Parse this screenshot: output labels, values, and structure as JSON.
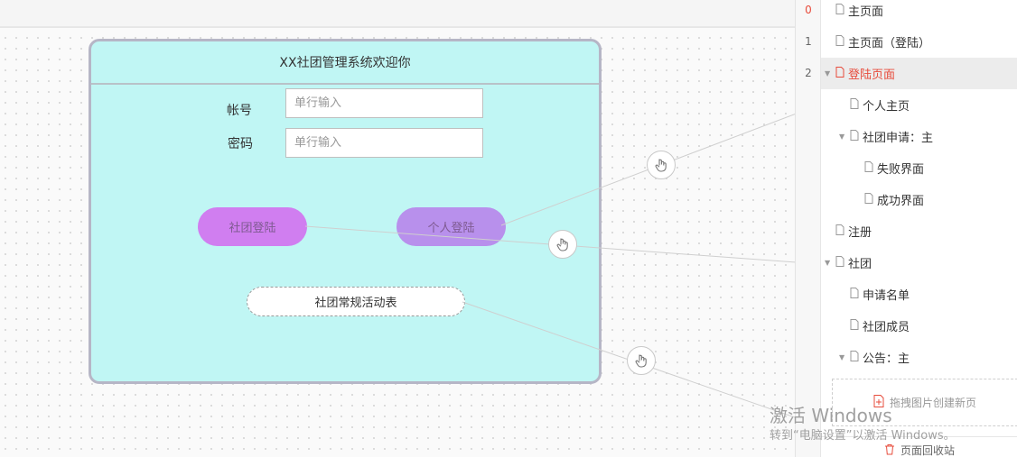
{
  "canvas": {
    "form": {
      "title": "XX社团管理系统欢迎你",
      "account_label": "帐号",
      "account_placeholder": "单行输入",
      "password_label": "密码",
      "password_placeholder": "单行输入",
      "club_login_label": "社团登陆",
      "personal_login_label": "个人登陆",
      "activity_label": "社团常规活动表"
    },
    "colors": {
      "phone_bg": "#c0f6f4",
      "club_login_bg": "#d07ef0",
      "personal_login_bg": "#b890ec",
      "active_page": "#e74c3c"
    }
  },
  "page_tree": {
    "items": [
      {
        "index": "0",
        "label": "主页面",
        "active": false,
        "expanded": false
      },
      {
        "index": "1",
        "label": "主页面（登陆）",
        "active": false,
        "expanded": false
      },
      {
        "index": "2",
        "label": "登陆页面",
        "active": true,
        "expanded": true
      },
      {
        "index": "",
        "label": "个人主页",
        "active": false,
        "expanded": false
      },
      {
        "index": "",
        "label": "社团申请：主",
        "active": false,
        "expanded": true
      },
      {
        "index": "",
        "label": "失败界面",
        "active": false,
        "expanded": false
      },
      {
        "index": "",
        "label": "成功界面",
        "active": false,
        "expanded": false
      },
      {
        "index": "",
        "label": "注册",
        "active": false,
        "expanded": false
      },
      {
        "index": "",
        "label": "社团",
        "active": false,
        "expanded": true
      },
      {
        "index": "",
        "label": "申请名单",
        "active": false,
        "expanded": false
      },
      {
        "index": "",
        "label": "社团成员",
        "active": false,
        "expanded": false
      },
      {
        "index": "",
        "label": "公告：主",
        "active": false,
        "expanded": true
      }
    ],
    "drop_zone_label": "拖拽图片创建新页",
    "recycle_label": "页面回收站"
  },
  "watermark": {
    "title": "激活 Windows",
    "subtitle": "转到“电脑设置”以激活 Windows。"
  },
  "icons": {
    "interaction_badge": "hand-pointer-icon",
    "page": "document-icon",
    "expand": "caret-down-icon",
    "drop_zone": "image-add-icon",
    "recycle": "trash-icon"
  }
}
